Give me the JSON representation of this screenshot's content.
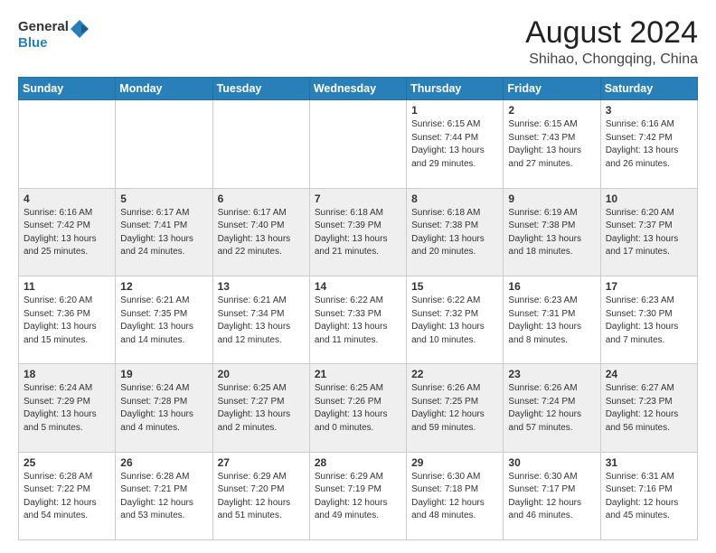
{
  "header": {
    "logo_general": "General",
    "logo_blue": "Blue",
    "month_year": "August 2024",
    "location": "Shihao, Chongqing, China"
  },
  "weekdays": [
    "Sunday",
    "Monday",
    "Tuesday",
    "Wednesday",
    "Thursday",
    "Friday",
    "Saturday"
  ],
  "rows": [
    [
      {
        "num": "",
        "info": ""
      },
      {
        "num": "",
        "info": ""
      },
      {
        "num": "",
        "info": ""
      },
      {
        "num": "",
        "info": ""
      },
      {
        "num": "1",
        "info": "Sunrise: 6:15 AM\nSunset: 7:44 PM\nDaylight: 13 hours\nand 29 minutes."
      },
      {
        "num": "2",
        "info": "Sunrise: 6:15 AM\nSunset: 7:43 PM\nDaylight: 13 hours\nand 27 minutes."
      },
      {
        "num": "3",
        "info": "Sunrise: 6:16 AM\nSunset: 7:42 PM\nDaylight: 13 hours\nand 26 minutes."
      }
    ],
    [
      {
        "num": "4",
        "info": "Sunrise: 6:16 AM\nSunset: 7:42 PM\nDaylight: 13 hours\nand 25 minutes."
      },
      {
        "num": "5",
        "info": "Sunrise: 6:17 AM\nSunset: 7:41 PM\nDaylight: 13 hours\nand 24 minutes."
      },
      {
        "num": "6",
        "info": "Sunrise: 6:17 AM\nSunset: 7:40 PM\nDaylight: 13 hours\nand 22 minutes."
      },
      {
        "num": "7",
        "info": "Sunrise: 6:18 AM\nSunset: 7:39 PM\nDaylight: 13 hours\nand 21 minutes."
      },
      {
        "num": "8",
        "info": "Sunrise: 6:18 AM\nSunset: 7:38 PM\nDaylight: 13 hours\nand 20 minutes."
      },
      {
        "num": "9",
        "info": "Sunrise: 6:19 AM\nSunset: 7:38 PM\nDaylight: 13 hours\nand 18 minutes."
      },
      {
        "num": "10",
        "info": "Sunrise: 6:20 AM\nSunset: 7:37 PM\nDaylight: 13 hours\nand 17 minutes."
      }
    ],
    [
      {
        "num": "11",
        "info": "Sunrise: 6:20 AM\nSunset: 7:36 PM\nDaylight: 13 hours\nand 15 minutes."
      },
      {
        "num": "12",
        "info": "Sunrise: 6:21 AM\nSunset: 7:35 PM\nDaylight: 13 hours\nand 14 minutes."
      },
      {
        "num": "13",
        "info": "Sunrise: 6:21 AM\nSunset: 7:34 PM\nDaylight: 13 hours\nand 12 minutes."
      },
      {
        "num": "14",
        "info": "Sunrise: 6:22 AM\nSunset: 7:33 PM\nDaylight: 13 hours\nand 11 minutes."
      },
      {
        "num": "15",
        "info": "Sunrise: 6:22 AM\nSunset: 7:32 PM\nDaylight: 13 hours\nand 10 minutes."
      },
      {
        "num": "16",
        "info": "Sunrise: 6:23 AM\nSunset: 7:31 PM\nDaylight: 13 hours\nand 8 minutes."
      },
      {
        "num": "17",
        "info": "Sunrise: 6:23 AM\nSunset: 7:30 PM\nDaylight: 13 hours\nand 7 minutes."
      }
    ],
    [
      {
        "num": "18",
        "info": "Sunrise: 6:24 AM\nSunset: 7:29 PM\nDaylight: 13 hours\nand 5 minutes."
      },
      {
        "num": "19",
        "info": "Sunrise: 6:24 AM\nSunset: 7:28 PM\nDaylight: 13 hours\nand 4 minutes."
      },
      {
        "num": "20",
        "info": "Sunrise: 6:25 AM\nSunset: 7:27 PM\nDaylight: 13 hours\nand 2 minutes."
      },
      {
        "num": "21",
        "info": "Sunrise: 6:25 AM\nSunset: 7:26 PM\nDaylight: 13 hours\nand 0 minutes."
      },
      {
        "num": "22",
        "info": "Sunrise: 6:26 AM\nSunset: 7:25 PM\nDaylight: 12 hours\nand 59 minutes."
      },
      {
        "num": "23",
        "info": "Sunrise: 6:26 AM\nSunset: 7:24 PM\nDaylight: 12 hours\nand 57 minutes."
      },
      {
        "num": "24",
        "info": "Sunrise: 6:27 AM\nSunset: 7:23 PM\nDaylight: 12 hours\nand 56 minutes."
      }
    ],
    [
      {
        "num": "25",
        "info": "Sunrise: 6:28 AM\nSunset: 7:22 PM\nDaylight: 12 hours\nand 54 minutes."
      },
      {
        "num": "26",
        "info": "Sunrise: 6:28 AM\nSunset: 7:21 PM\nDaylight: 12 hours\nand 53 minutes."
      },
      {
        "num": "27",
        "info": "Sunrise: 6:29 AM\nSunset: 7:20 PM\nDaylight: 12 hours\nand 51 minutes."
      },
      {
        "num": "28",
        "info": "Sunrise: 6:29 AM\nSunset: 7:19 PM\nDaylight: 12 hours\nand 49 minutes."
      },
      {
        "num": "29",
        "info": "Sunrise: 6:30 AM\nSunset: 7:18 PM\nDaylight: 12 hours\nand 48 minutes."
      },
      {
        "num": "30",
        "info": "Sunrise: 6:30 AM\nSunset: 7:17 PM\nDaylight: 12 hours\nand 46 minutes."
      },
      {
        "num": "31",
        "info": "Sunrise: 6:31 AM\nSunset: 7:16 PM\nDaylight: 12 hours\nand 45 minutes."
      }
    ]
  ]
}
